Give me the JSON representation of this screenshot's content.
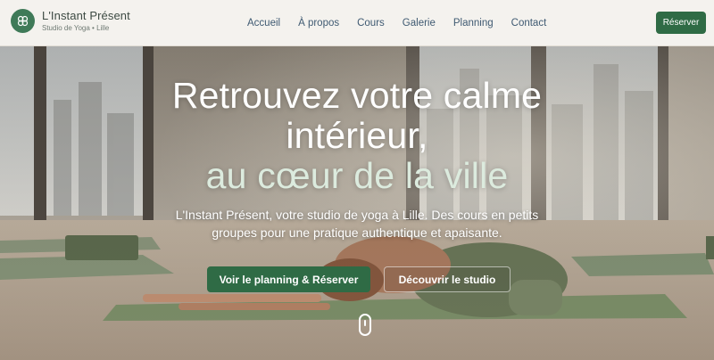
{
  "brand": {
    "name": "L'Instant Présent",
    "tagline": "Studio de Yoga • Lille",
    "logo_icon": "flower-icon"
  },
  "nav": {
    "items": [
      "Accueil",
      "À propos",
      "Cours",
      "Galerie",
      "Planning",
      "Contact"
    ],
    "cta_label": "Réserver"
  },
  "hero": {
    "title_line1": "Retrouvez votre calme",
    "title_line2": "intérieur,",
    "title_line3": "au cœur de la ville",
    "subtitle": "L'Instant Présent, votre studio de yoga à Lille. Des cours en petits groupes pour une pratique authentique et apaisante.",
    "primary_button": "Voir le planning & Réserver",
    "secondary_button": "Découvrir le studio",
    "scroll_icon": "scroll-mouse-icon"
  },
  "colors": {
    "brand_green": "#2f6b45",
    "logo_green": "#3f7a58",
    "nav_text": "#3f5a72",
    "header_bg": "#f4f2ee",
    "title_accent": "#dcebde"
  }
}
